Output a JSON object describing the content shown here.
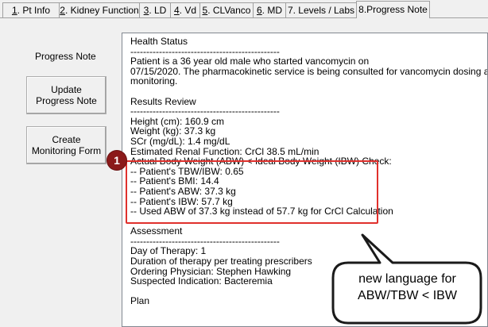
{
  "tabs": [
    {
      "acc": "1",
      "label": ". Pt Info",
      "active": false
    },
    {
      "acc": "2",
      "label": ". Kidney Function",
      "active": false
    },
    {
      "acc": "3",
      "label": ". LD",
      "active": false
    },
    {
      "acc": "4",
      "label": ". Vd",
      "active": false
    },
    {
      "acc": "5",
      "label": ". CLVanco",
      "active": false
    },
    {
      "acc": "6",
      "label": ". MD",
      "active": false
    },
    {
      "acc": "",
      "label": "7. Levels / Labs",
      "active": false
    },
    {
      "acc": "",
      "label": "8.Progress Note",
      "active": true
    }
  ],
  "sidebar": {
    "title": "Progress Note",
    "update_button": "Update\nProgress Note",
    "create_button": "Create\nMonitoring Form"
  },
  "note": {
    "health_status": {
      "heading": "Health Status",
      "rule": "-----------------------------------------------",
      "line1": "Patient is a 36 year old male who started vancomycin on",
      "line2": "07/15/2020. The pharmacokinetic service is being consulted for vancomycin dosing and",
      "line3": "monitoring."
    },
    "results_review": {
      "heading": "Results Review",
      "rule": "-----------------------------------------------",
      "height": "Height (cm): 160.9 cm",
      "weight": "Weight (kg): 37.3 kg",
      "scr": "SCr (mg/dL): 1.4 mg/dL",
      "renal": "Estimated Renal Function: CrCl 38.5 mL/min",
      "abw_check": "Actual Body Weight (ABW) < Ideal Body Weight (IBW) Check:",
      "tbw_ibw": "-- Patient's TBW/IBW: 0.65",
      "bmi": "-- Patient's BMI: 14.4",
      "abw": "-- Patient's ABW: 37.3 kg",
      "ibw": "-- Patient's IBW: 57.7 kg",
      "used": "-- Used ABW of 37.3 kg instead of 57.7 kg for CrCl Calculation"
    },
    "assessment": {
      "heading": "Assessment",
      "rule": "-----------------------------------------------",
      "day": "Day of Therapy: 1",
      "duration": "Duration of therapy per treating prescribers",
      "physician": "Ordering Physician: Stephen Hawking",
      "indication": "Suspected Indication: Bacteremia"
    },
    "plan": {
      "heading": "Plan"
    }
  },
  "annotation": {
    "badge": "1",
    "callout": "new language for\nABW/TBW < IBW",
    "highlight_color": "#e0302c",
    "badge_color": "#8b1a1a"
  }
}
